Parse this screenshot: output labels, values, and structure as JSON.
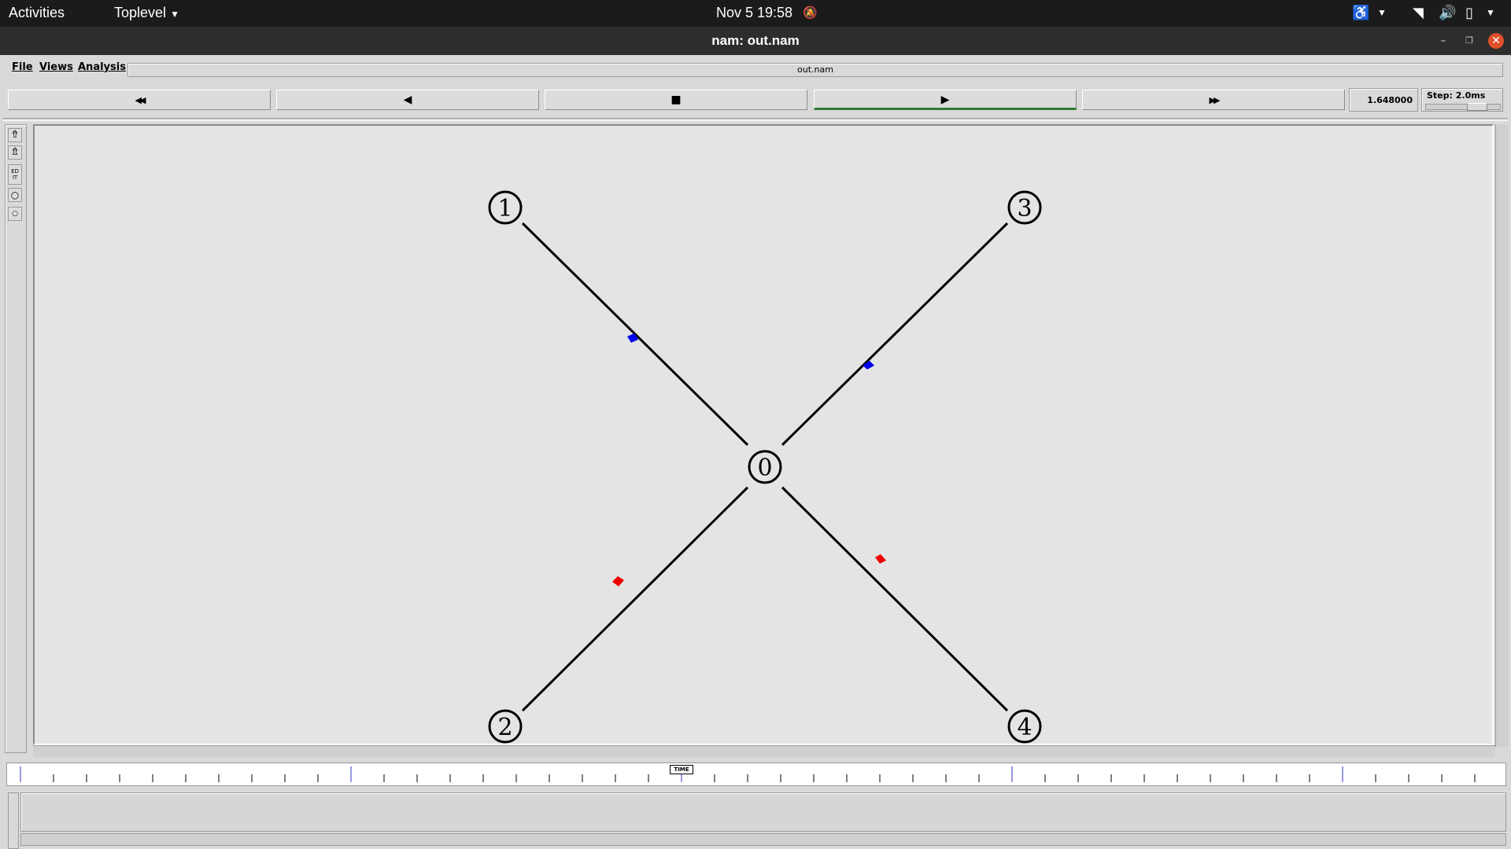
{
  "topbar": {
    "activities": "Activities",
    "app_menu": "Toplevel",
    "clock": "Nov 5  19:58"
  },
  "window": {
    "title": "nam: out.nam"
  },
  "menu": {
    "file": "File",
    "views": "Views",
    "analysis": "Analysis"
  },
  "trace_file": "out.nam",
  "transport": {
    "rewind": "◀◀",
    "back": "◀",
    "stop": "■",
    "play": "▶",
    "fast_forward": "▶▶"
  },
  "time_readout": "1.648000",
  "step": "Step: 2.0ms",
  "timeline_marker": "TIME",
  "nodes": [
    {
      "id": "0",
      "label": "0"
    },
    {
      "id": "1",
      "label": "1"
    },
    {
      "id": "2",
      "label": "2"
    },
    {
      "id": "3",
      "label": "3"
    },
    {
      "id": "4",
      "label": "4"
    }
  ],
  "links": [
    {
      "from": "0",
      "to": "1"
    },
    {
      "from": "0",
      "to": "2"
    },
    {
      "from": "0",
      "to": "3"
    },
    {
      "from": "0",
      "to": "4"
    }
  ],
  "packet_colors": {
    "flow_blue": "#0000ee",
    "flow_red": "#ee0000"
  },
  "left_tools": [
    "zoom-in",
    "zoom-out",
    "EDIT",
    "node-tool",
    "small-node-tool"
  ]
}
